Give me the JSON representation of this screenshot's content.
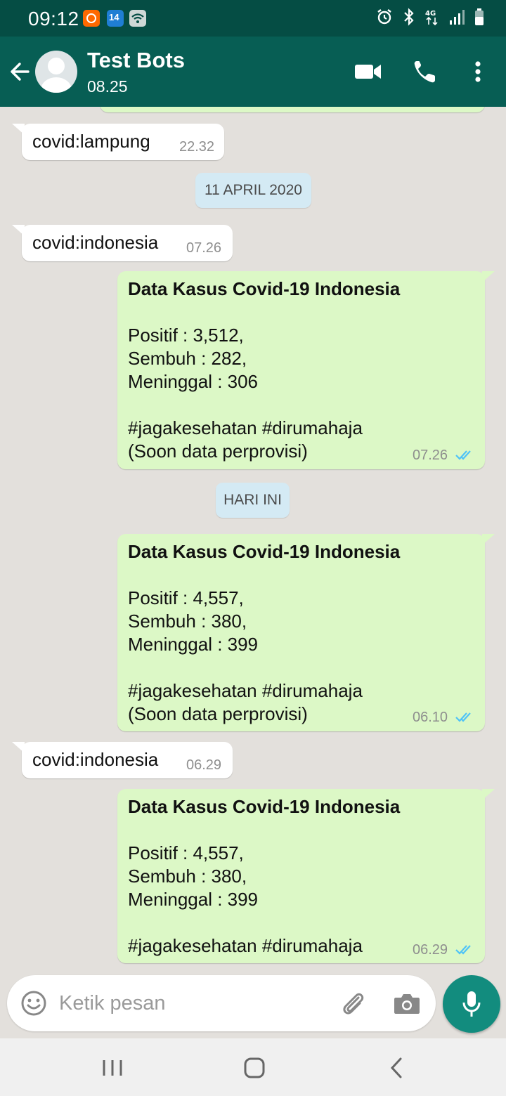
{
  "status_bar": {
    "time": "09:12",
    "icons": [
      "mi-app-icon",
      "calendar-icon",
      "wifi-icon",
      "alarm-icon",
      "bluetooth-icon",
      "4g-icon",
      "signal-icon",
      "battery-icon"
    ]
  },
  "header": {
    "contact_name": "Test Bots",
    "contact_status": "08.25",
    "icons": [
      "back-arrow-icon",
      "avatar-icon",
      "video-call-icon",
      "phone-icon",
      "more-vert-icon"
    ]
  },
  "messages": [
    {
      "type": "in",
      "text": "covid:lampung",
      "time": "22.32"
    },
    {
      "type": "date",
      "text": "11 APRIL 2020"
    },
    {
      "type": "in",
      "text": "covid:indonesia",
      "time": "07.26"
    },
    {
      "type": "out",
      "title": "Data Kasus Covid-19 Indonesia",
      "lines": [
        "Positif : 3,512,",
        "Sembuh : 282,",
        "Meninggal : 306"
      ],
      "tags": "#jagakesehatan #dirumahaja",
      "note": "(Soon data perprovisi)",
      "time": "07.26",
      "status": "read"
    },
    {
      "type": "date",
      "text": "HARI INI"
    },
    {
      "type": "out",
      "title": "Data Kasus Covid-19 Indonesia",
      "lines": [
        "Positif : 4,557,",
        "Sembuh : 380,",
        "Meninggal : 399"
      ],
      "tags": "#jagakesehatan #dirumahaja",
      "note": "(Soon data perprovisi)",
      "time": "06.10",
      "status": "read"
    },
    {
      "type": "in",
      "text": "covid:indonesia",
      "time": "06.29"
    },
    {
      "type": "out",
      "title": "Data Kasus Covid-19 Indonesia",
      "lines": [
        "Positif : 4,557,",
        "Sembuh : 380,",
        "Meninggal : 399"
      ],
      "tags": "#jagakesehatan #dirumahaja",
      "time": "06.29",
      "status": "read"
    }
  ],
  "input": {
    "placeholder": "Ketik pesan",
    "icons": [
      "emoji-icon",
      "attach-icon",
      "camera-icon",
      "mic-icon"
    ]
  },
  "colors": {
    "status_bar": "#054d44",
    "app_bar": "#075e54",
    "outgoing_bubble": "#dcf8c6",
    "incoming_bubble": "#ffffff",
    "chat_background": "#e3e0dc",
    "read_ticks": "#4fc3f7",
    "mic_button": "#128c7e"
  }
}
